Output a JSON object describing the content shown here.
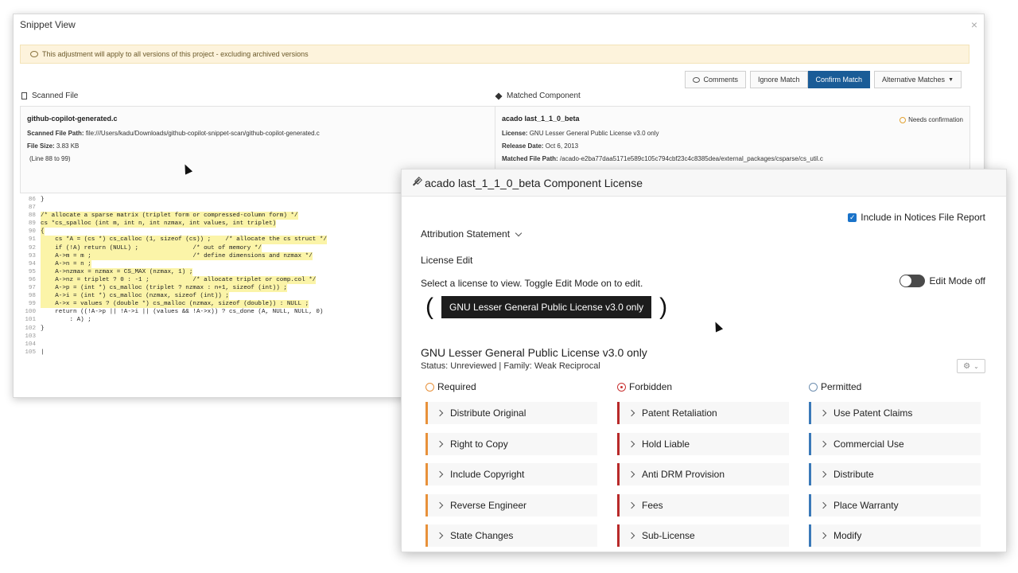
{
  "snippet_view": {
    "title": "Snippet View",
    "close": "×",
    "notice": "This adjustment will apply to all versions of this project - excluding archived versions",
    "buttons": {
      "comments": "Comments",
      "ignore": "Ignore Match",
      "confirm": "Confirm Match",
      "alternative": "Alternative Matches"
    },
    "scanned": {
      "header": "Scanned File",
      "file_name": "github-copilot-generated.c",
      "path_label": "Scanned File Path:",
      "path_value": "file:///Users/kadu/Downloads/github-copilot-snippet-scan/github-copilot-generated.c",
      "size_label": "File Size:",
      "size_value": "3.83 KB",
      "lines": "(Line 88 to 99)"
    },
    "matched": {
      "header": "Matched Component",
      "component": "acado last_1_1_0_beta",
      "status": "Needs confirmation",
      "license_label": "License:",
      "license_value": "GNU Lesser General Public License v3.0 only",
      "release_label": "Release Date:",
      "release_value": "Oct 6, 2013",
      "path_label": "Matched File Path:",
      "path_value": "/acado-e2ba77daa5171e589c105c794cbf23c4c8385dea/external_packages/csparse/cs_util.c"
    },
    "code": [
      {
        "n": "86",
        "t": "}",
        "hl": false
      },
      {
        "n": "87",
        "t": "",
        "hl": false
      },
      {
        "n": "88",
        "t": "/* allocate a sparse matrix (triplet form or compressed-column form) */",
        "hl": true
      },
      {
        "n": "89",
        "t": "cs *cs_spalloc (int m, int n, int nzmax, int values, int triplet)",
        "hl": true
      },
      {
        "n": "90",
        "t": "{",
        "hl": true
      },
      {
        "n": "91",
        "t": "    cs *A = (cs *) cs_calloc (1, sizeof (cs)) ;    /* allocate the cs struct */",
        "hl": true
      },
      {
        "n": "92",
        "t": "    if (!A) return (NULL) ;               /* out of memory */",
        "hl": true
      },
      {
        "n": "93",
        "t": "    A->m = m ;                            /* define dimensions and nzmax */",
        "hl": true
      },
      {
        "n": "94",
        "t": "    A->n = n ;",
        "hl": true
      },
      {
        "n": "95",
        "t": "    A->nzmax = nzmax = CS_MAX (nzmax, 1) ;",
        "hl": true
      },
      {
        "n": "96",
        "t": "    A->nz = triplet ? 0 : -1 ;            /* allocate triplet or comp.col */",
        "hl": true
      },
      {
        "n": "97",
        "t": "    A->p = (int *) cs_malloc (triplet ? nzmax : n+1, sizeof (int)) ;",
        "hl": true
      },
      {
        "n": "98",
        "t": "    A->i = (int *) cs_malloc (nzmax, sizeof (int)) ;",
        "hl": true
      },
      {
        "n": "99",
        "t": "    A->x = values ? (double *) cs_malloc (nzmax, sizeof (double)) : NULL ;",
        "hl": true
      },
      {
        "n": "100",
        "t": "    return ((!A->p || !A->i || (values && !A->x)) ? cs_done (A, NULL, NULL, 0)",
        "hl": false
      },
      {
        "n": "101",
        "t": "        : A) ;",
        "hl": false
      },
      {
        "n": "102",
        "t": "}",
        "hl": false
      },
      {
        "n": "103",
        "t": "",
        "hl": false
      },
      {
        "n": "104",
        "t": "",
        "hl": false
      },
      {
        "n": "105",
        "t": "|",
        "hl": false
      }
    ]
  },
  "license_window": {
    "title": "acado last_1_1_0_beta Component License",
    "include_notices": "Include in Notices File Report",
    "attribution": "Attribution Statement",
    "license_edit": "License Edit",
    "select_hint": "Select a license to view. Toggle Edit Mode on to edit.",
    "edit_mode": "Edit Mode off",
    "paren_open": "(",
    "paren_close": ")",
    "selected_license": "GNU Lesser General Public License v3.0 only",
    "license_name": "GNU Lesser General Public License v3.0 only",
    "license_meta": "Status:  Unreviewed | Family:  Weak Reciprocal",
    "required": {
      "label": "Required",
      "items": [
        "Distribute Original",
        "Right to Copy",
        "Include Copyright",
        "Reverse Engineer",
        "State Changes"
      ]
    },
    "forbidden": {
      "label": "Forbidden",
      "items": [
        "Patent Retaliation",
        "Hold Liable",
        "Anti DRM Provision",
        "Fees",
        "Sub-License"
      ]
    },
    "permitted": {
      "label": "Permitted",
      "items": [
        "Use Patent Claims",
        "Commercial Use",
        "Distribute",
        "Place Warranty",
        "Modify"
      ]
    }
  },
  "colors": {
    "primary": "#1a5c97",
    "required": "#e8913a",
    "forbidden": "#b82a2a",
    "permitted": "#3a79b8",
    "highlight": "#fbf4a8"
  }
}
